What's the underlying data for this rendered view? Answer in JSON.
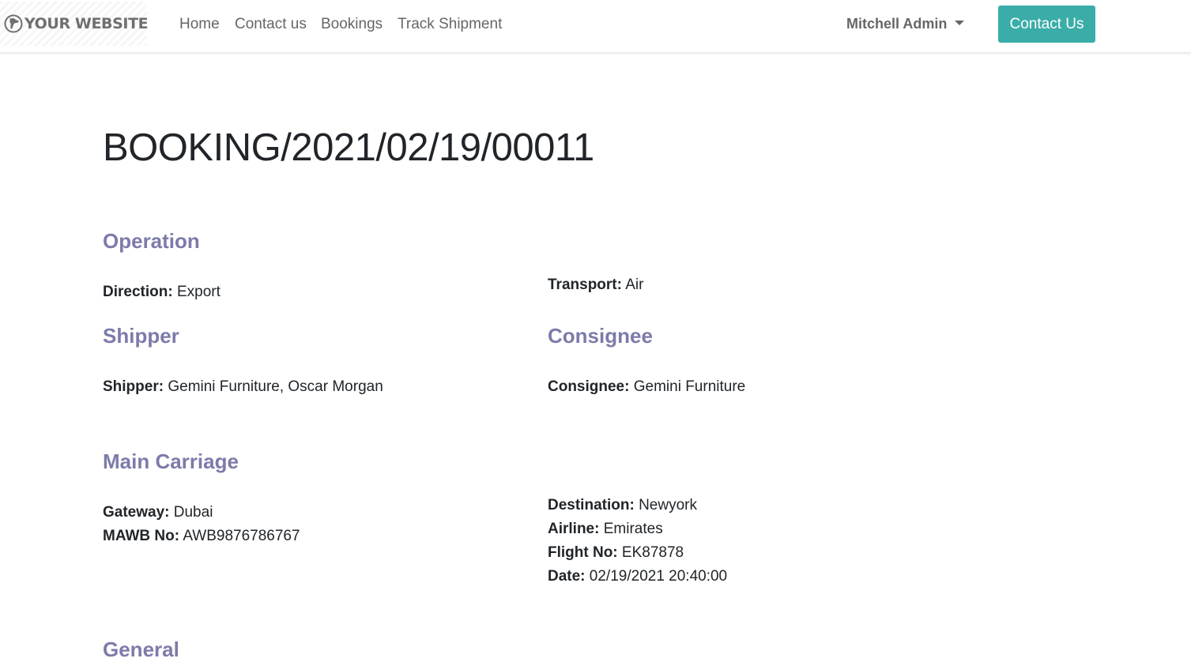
{
  "nav": {
    "logo_text": "YOUR WEBSITE",
    "logo_icon": "globe-icon",
    "links": [
      "Home",
      "Contact us",
      "Bookings",
      "Track Shipment"
    ],
    "user_name": "Mitchell Admin",
    "cta_label": "Contact Us",
    "cta_color": "#3aada8"
  },
  "page": {
    "title": "BOOKING/2021/02/19/00011",
    "heading_color": "#7c7baa"
  },
  "operation": {
    "heading": "Operation",
    "direction_label": "Direction:",
    "direction_value": "Export",
    "transport_label": "Transport:",
    "transport_value": "Air"
  },
  "shipper": {
    "heading": "Shipper",
    "label": "Shipper:",
    "value": "Gemini Furniture, Oscar Morgan"
  },
  "consignee": {
    "heading": "Consignee",
    "label": "Consignee:",
    "value": "Gemini Furniture"
  },
  "main_carriage": {
    "heading": "Main Carriage",
    "gateway_label": "Gateway:",
    "gateway_value": "Dubai",
    "mawb_label": "MAWB No:",
    "mawb_value": "AWB9876786767",
    "destination_label": "Destination:",
    "destination_value": "Newyork",
    "airline_label": "Airline:",
    "airline_value": "Emirates",
    "flight_label": "Flight No:",
    "flight_value": "EK87878",
    "date_label": "Date:",
    "date_value": "02/19/2021 20:40:00"
  },
  "general": {
    "heading": "General"
  }
}
